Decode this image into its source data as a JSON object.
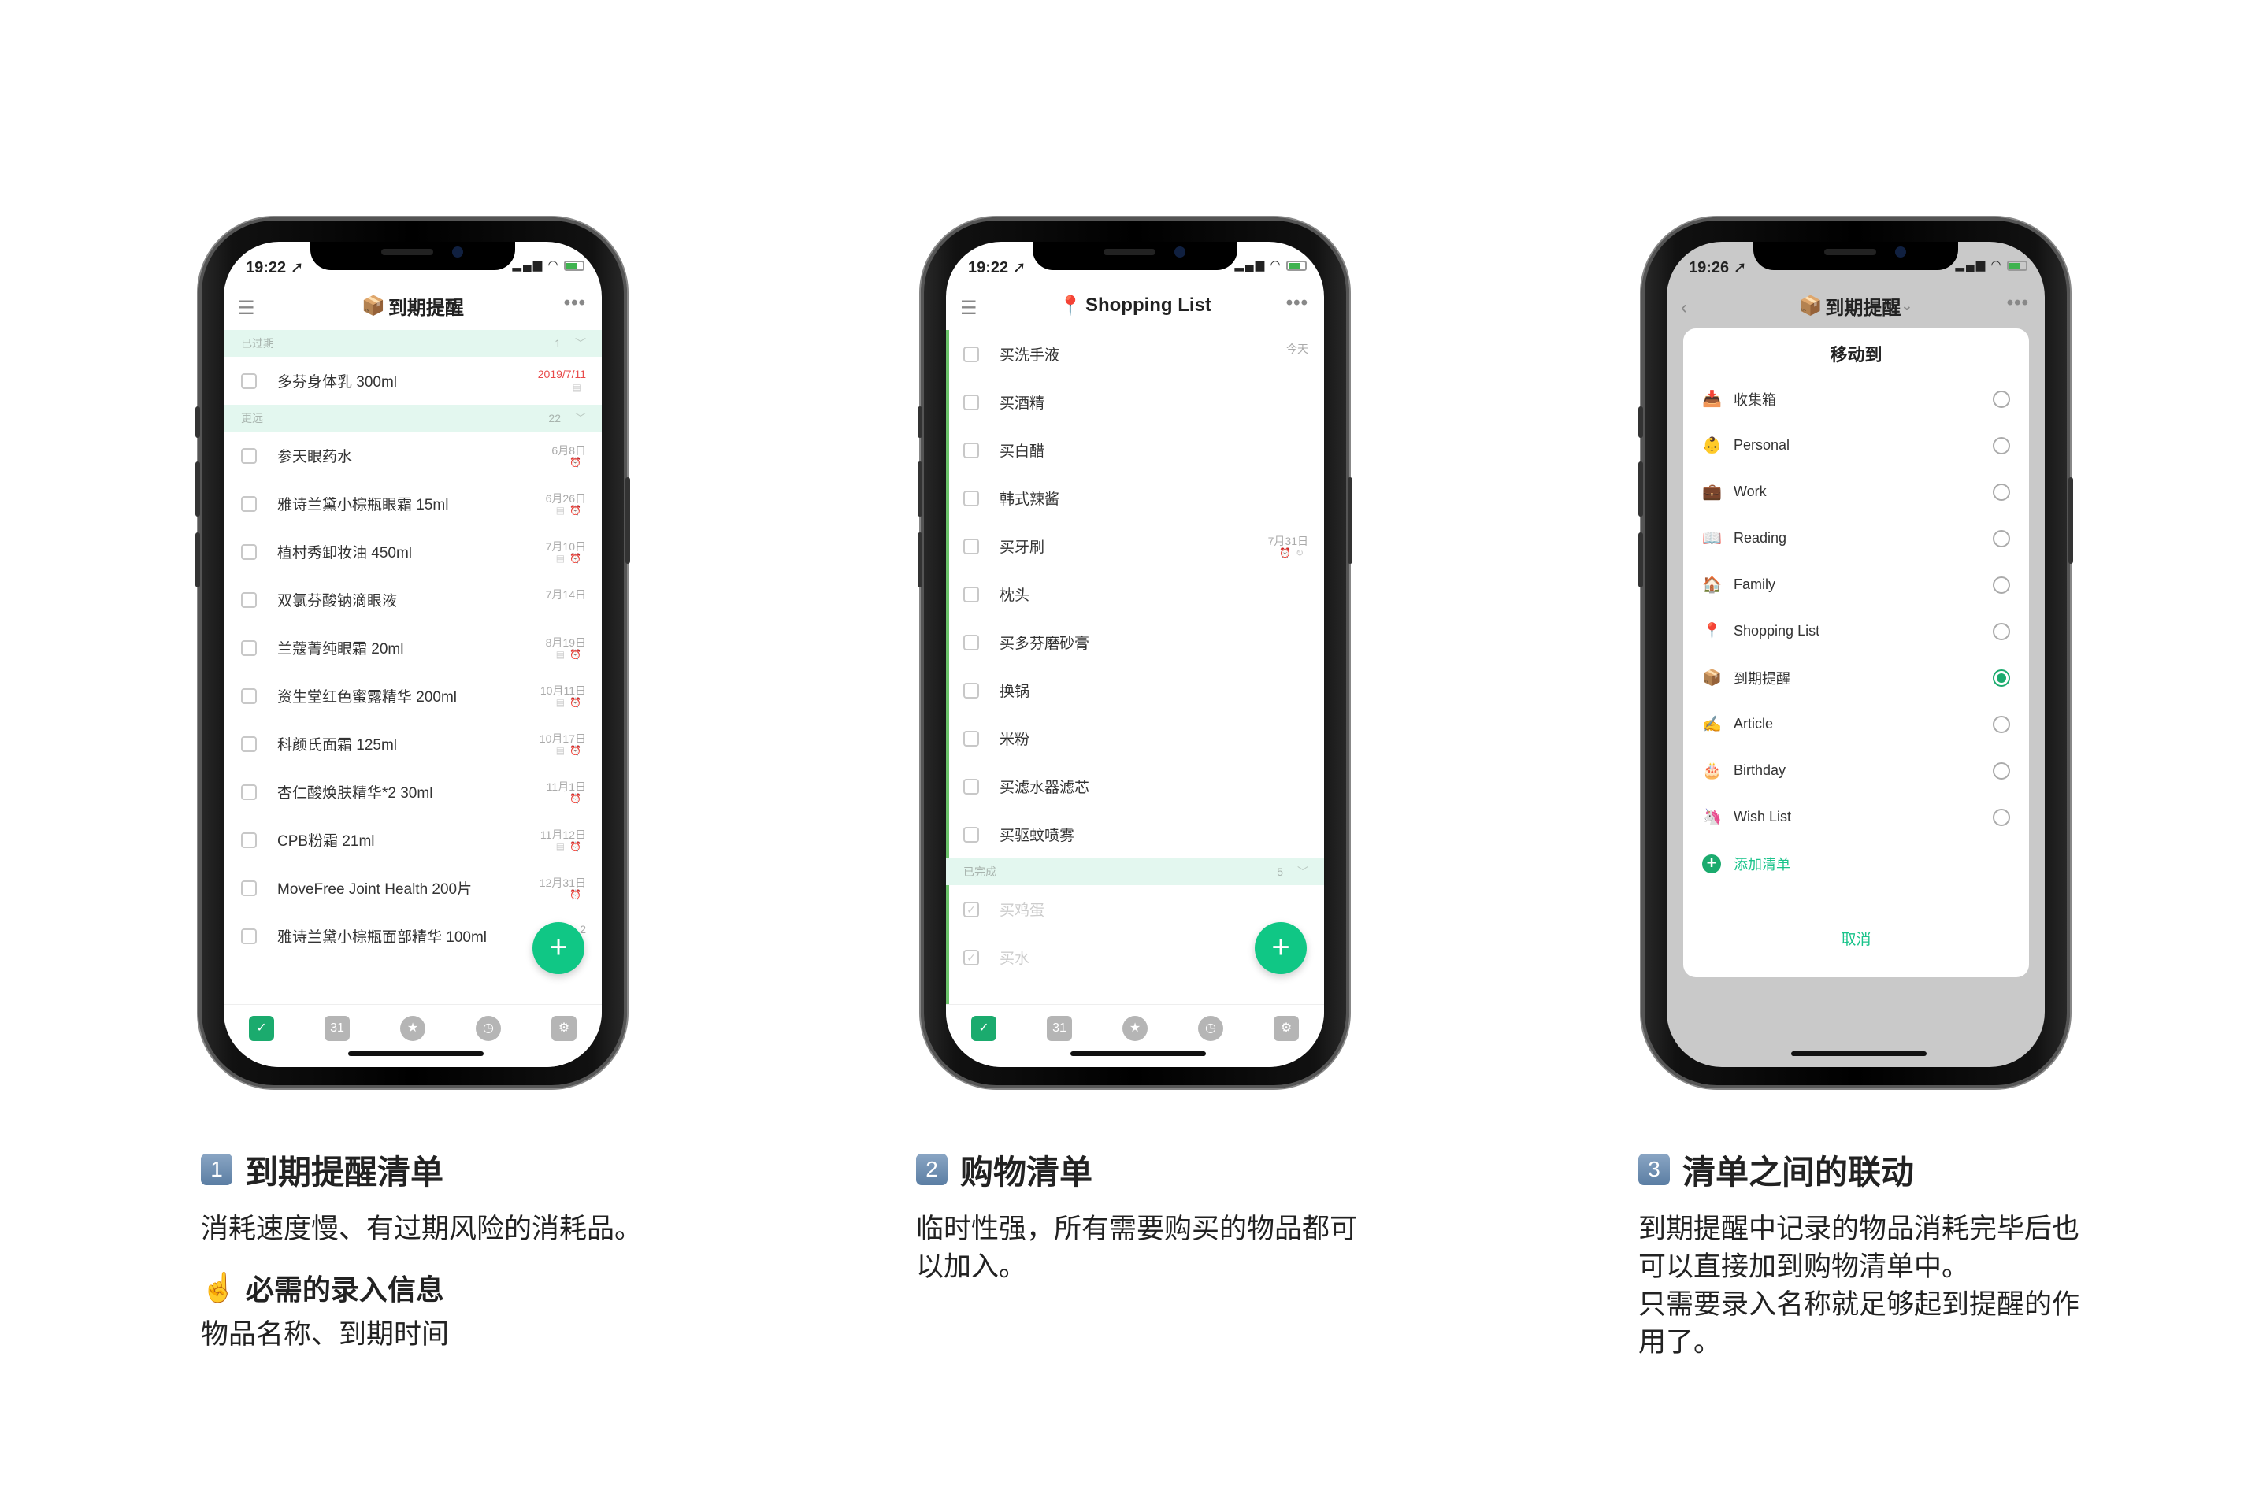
{
  "accent": "#10c785",
  "phones": [
    {
      "time": "19:22 ➚",
      "nav": {
        "emoji": "📦",
        "title": "到期提醒",
        "menu_icon": "menu-icon",
        "more_icon": "more-icon"
      },
      "sections": [
        {
          "header": "已过期",
          "count": "1",
          "rows": [
            {
              "name": "多芬身体乳 300ml",
              "date": "2019/7/11",
              "overdue": true,
              "note": true,
              "alarm": false
            }
          ]
        },
        {
          "header": "更远",
          "count": "22",
          "rows": [
            {
              "name": "参天眼药水",
              "date": "6月8日",
              "note": false,
              "alarm": true
            },
            {
              "name": "雅诗兰黛小棕瓶眼霜 15ml",
              "date": "6月26日",
              "note": true,
              "alarm": true
            },
            {
              "name": "植村秀卸妆油 450ml",
              "date": "7月10日",
              "note": true,
              "alarm": true
            },
            {
              "name": "双氯芬酸钠滴眼液",
              "date": "7月14日",
              "note": false,
              "alarm": false
            },
            {
              "name": "兰蔻菁纯眼霜 20ml",
              "date": "8月19日",
              "note": true,
              "alarm": true
            },
            {
              "name": "资生堂红色蜜露精华 200ml",
              "date": "10月11日",
              "note": true,
              "alarm": true
            },
            {
              "name": "科颜氏面霜 125ml",
              "date": "10月17日",
              "note": true,
              "alarm": true
            },
            {
              "name": "杏仁酸焕肤精华*2 30ml",
              "date": "11月1日",
              "note": false,
              "alarm": true
            },
            {
              "name": "CPB粉霜 21ml",
              "date": "11月12日",
              "note": true,
              "alarm": true
            },
            {
              "name": "MoveFree Joint Health 200片",
              "date": "12月31日",
              "note": false,
              "alarm": true
            },
            {
              "name": "雅诗兰黛小棕瓶面部精华 100ml",
              "date": "2",
              "note": false,
              "alarm": false
            }
          ]
        }
      ]
    },
    {
      "time": "19:22 ➚",
      "nav": {
        "emoji": "📍",
        "title": "Shopping List"
      },
      "sections": [
        {
          "header": "",
          "rows": [
            {
              "name": "买洗手液",
              "date": "今天"
            },
            {
              "name": "买酒精"
            },
            {
              "name": "买白醋"
            },
            {
              "name": "韩式辣酱"
            },
            {
              "name": "买牙刷",
              "date": "7月31日",
              "alarm": true,
              "repeat": true
            },
            {
              "name": "枕头"
            },
            {
              "name": "买多芬磨砂膏"
            },
            {
              "name": "换锅"
            },
            {
              "name": "米粉"
            },
            {
              "name": "买滤水器滤芯"
            },
            {
              "name": "买驱蚊喷雾"
            }
          ]
        },
        {
          "header": "已完成",
          "count": "5",
          "rows": [
            {
              "name": "买鸡蛋",
              "done": true
            },
            {
              "name": "买水",
              "done": true
            }
          ]
        }
      ]
    },
    {
      "time": "19:26 ➚",
      "nav": {
        "emoji": "📦",
        "title": "到期提醒"
      },
      "modal": {
        "title": "移动到",
        "items": [
          {
            "emoji": "📥",
            "label": "收集箱",
            "selected": false
          },
          {
            "emoji": "👶",
            "label": "Personal",
            "selected": false
          },
          {
            "emoji": "💼",
            "label": "Work",
            "selected": false
          },
          {
            "emoji": "📖",
            "label": "Reading",
            "selected": false
          },
          {
            "emoji": "🏠",
            "label": "Family",
            "selected": false
          },
          {
            "emoji": "📍",
            "label": "Shopping List",
            "selected": false
          },
          {
            "emoji": "📦",
            "label": "到期提醒",
            "selected": true
          },
          {
            "emoji": "✍️",
            "label": "Article",
            "selected": false
          },
          {
            "emoji": "🎂",
            "label": "Birthday",
            "selected": false
          },
          {
            "emoji": "🦄",
            "label": "Wish List",
            "selected": false
          }
        ],
        "add_label": "添加清单",
        "cancel_label": "取消"
      }
    }
  ],
  "tabbar": {
    "calendar_day": "31",
    "icons": [
      "checkbox-icon",
      "calendar-icon",
      "pomodoro-icon",
      "habit-icon",
      "settings-icon"
    ]
  },
  "captions": [
    {
      "num": "1",
      "title": "到期提醒清单",
      "body": [
        "消耗速度慢、有过期风险的消耗品。"
      ],
      "sub_emoji": "☝️",
      "sub_title": "必需的录入信息",
      "sub_body": "物品名称、到期时间"
    },
    {
      "num": "2",
      "title": "购物清单",
      "body": [
        "临时性强，所有需要购买的物品都可",
        "以加入。"
      ]
    },
    {
      "num": "3",
      "title": "清单之间的联动",
      "body": [
        "到期提醒中记录的物品消耗完毕后也",
        "可以直接加到购物清单中。",
        "只需要录入名称就足够起到提醒的作",
        "用了。"
      ]
    }
  ]
}
